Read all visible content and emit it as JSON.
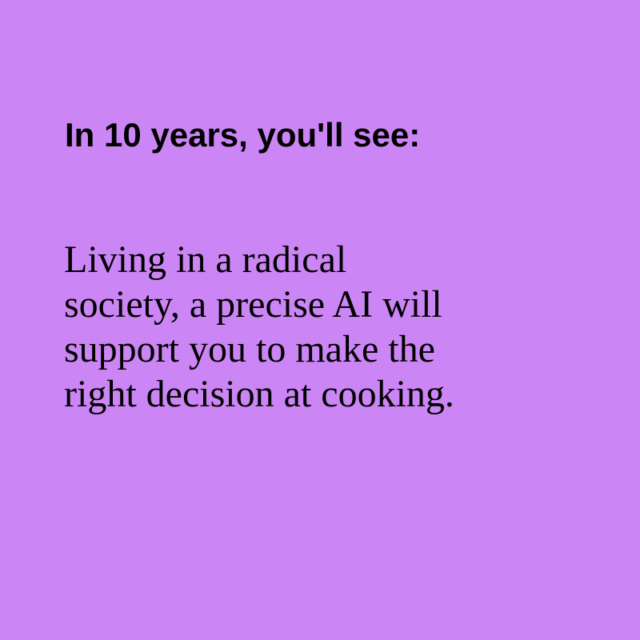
{
  "background_color": "#cc85f5",
  "text_color": "#000000",
  "heading": "In 10 years, you'll see:",
  "body_lines": [
    "Living in a radical",
    "society, a precise AI will",
    "support you to make the",
    "right decision at cooking."
  ]
}
